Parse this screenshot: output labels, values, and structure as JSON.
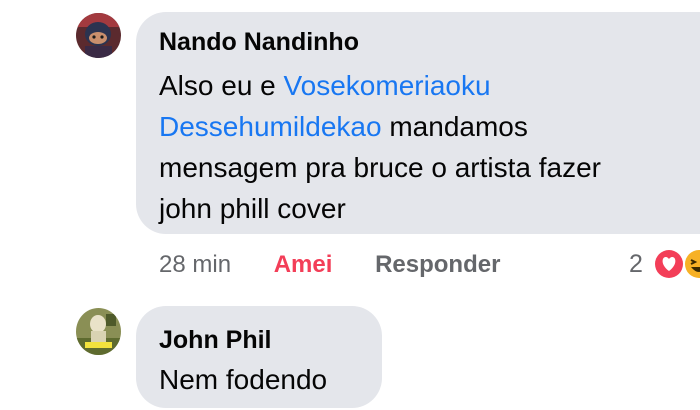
{
  "comments": [
    {
      "author": "Nando Nandinho",
      "lines": [
        {
          "prefix": "Also eu e ",
          "mention": "Vosekomeriaoku",
          "suffix": ""
        },
        {
          "prefix": "",
          "mention": "Dessehumildekao",
          "suffix": " mandamos"
        },
        {
          "prefix": "mensagem pra bruce o artista fazer",
          "mention": "",
          "suffix": ""
        },
        {
          "prefix": "john phill cover",
          "mention": "",
          "suffix": ""
        }
      ],
      "time": "28 min",
      "love_label": "Amei",
      "reply_label": "Responder",
      "reaction_count": "2",
      "reaction_icons": [
        "love-reaction-icon",
        "haha-reaction-icon"
      ]
    },
    {
      "author": "John Phil",
      "text": "Nem fodendo"
    }
  ],
  "colors": {
    "bubble": "#e4e6eb",
    "mention": "#1877f2",
    "love": "#f33e58",
    "muted": "#65676b",
    "text": "#050505"
  }
}
